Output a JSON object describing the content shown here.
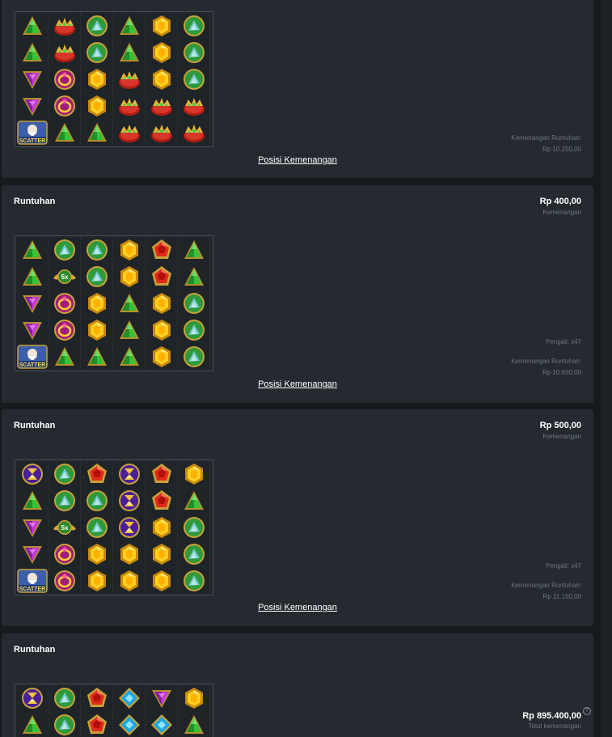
{
  "panels": [
    {
      "title": "",
      "amount": "",
      "amount_caption": "",
      "multiplier": "",
      "cascade_win_label": "Kemenangan Runtuhan:",
      "cascade_win_value": "Rp 10.250,00",
      "win_positions_link": "Posisi Kemenangan",
      "grid": [
        [
          "green-tri",
          "crown",
          "green-orb",
          "green-tri",
          "yellow-hex",
          "green-orb"
        ],
        [
          "green-tri",
          "crown",
          "green-orb",
          "green-tri",
          "yellow-hex",
          "green-orb"
        ],
        [
          "purple-tri",
          "ring",
          "yellow-hex",
          "crown",
          "yellow-hex",
          "green-orb"
        ],
        [
          "purple-tri",
          "ring",
          "yellow-hex",
          "crown",
          "crown",
          "crown"
        ],
        [
          "scatter",
          "green-tri",
          "green-tri",
          "crown",
          "crown",
          "crown"
        ]
      ]
    },
    {
      "title": "Runtuhan",
      "amount": "Rp 400,00",
      "amount_caption": "Kemenangan",
      "multiplier": "Pengali: x47",
      "cascade_win_label": "Kemenangan Runtuhan:",
      "cascade_win_value": "Rp 10.650,00",
      "win_positions_link": "Posisi Kemenangan",
      "grid": [
        [
          "green-tri",
          "green-orb",
          "green-orb",
          "yellow-hex",
          "red-pent",
          "green-tri"
        ],
        [
          "green-tri",
          "mult-5x",
          "green-orb",
          "yellow-hex",
          "red-pent",
          "green-tri"
        ],
        [
          "purple-tri",
          "ring",
          "yellow-hex",
          "green-tri",
          "yellow-hex",
          "green-orb"
        ],
        [
          "purple-tri",
          "ring",
          "yellow-hex",
          "green-tri",
          "yellow-hex",
          "green-orb"
        ],
        [
          "scatter",
          "green-tri",
          "green-tri",
          "green-tri",
          "yellow-hex",
          "green-orb"
        ]
      ]
    },
    {
      "title": "Runtuhan",
      "amount": "Rp 500,00",
      "amount_caption": "Kemenangan",
      "multiplier": "Pengali: x47",
      "cascade_win_label": "Kemenangan Runtuhan:",
      "cascade_win_value": "Rp 11.150,00",
      "win_positions_link": "Posisi Kemenangan",
      "grid": [
        [
          "hourglass",
          "green-orb",
          "red-pent",
          "hourglass",
          "red-pent",
          "yellow-hex"
        ],
        [
          "green-tri",
          "green-orb",
          "green-orb",
          "hourglass",
          "red-pent",
          "green-tri"
        ],
        [
          "purple-tri",
          "mult-5x",
          "green-orb",
          "hourglass",
          "yellow-hex",
          "green-orb"
        ],
        [
          "purple-tri",
          "ring",
          "yellow-hex",
          "yellow-hex",
          "yellow-hex",
          "green-orb"
        ],
        [
          "scatter",
          "ring",
          "yellow-hex",
          "yellow-hex",
          "yellow-hex",
          "green-orb"
        ]
      ]
    },
    {
      "title": "Runtuhan",
      "total_amount": "Rp 895.400,00",
      "total_caption": "Total kemenangan",
      "help_glyph": "?",
      "grid": [
        [
          "hourglass",
          "green-orb",
          "red-pent",
          "blue-diamond",
          "purple-tri",
          "yellow-hex"
        ],
        [
          "green-tri",
          "green-orb",
          "red-pent",
          "blue-diamond",
          "blue-diamond",
          "green-tri"
        ]
      ]
    }
  ],
  "symbol_labels": {
    "mult-5x": "5x",
    "scatter": "SCATTER"
  },
  "colors": {
    "background": "#161a1d",
    "panel": "#242a2f",
    "text": "#ffffff",
    "muted": "#6e767c"
  }
}
